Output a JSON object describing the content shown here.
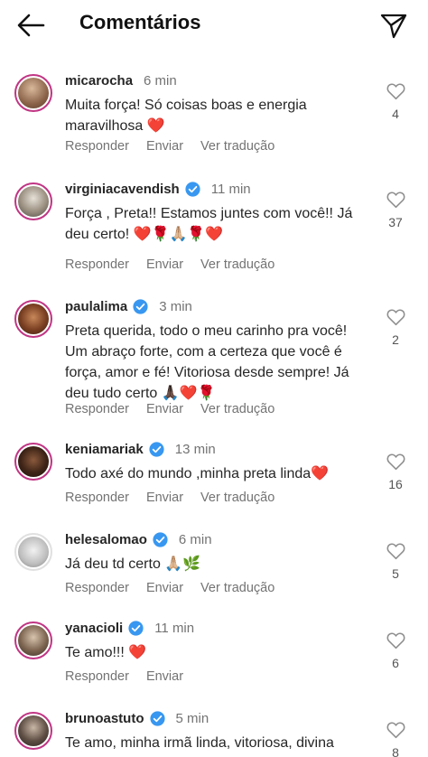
{
  "header": {
    "title": "Comentários"
  },
  "actions": {
    "reply": "Responder",
    "send": "Enviar",
    "translate": "Ver tradução"
  },
  "comments": [
    {
      "username": "micarocha",
      "time": "6 min",
      "text": "Muita força! Só coisas boas e energia maravilhosa ❤️",
      "likes": "4",
      "verified": false
    },
    {
      "username": "virginiacavendish",
      "time": "11 min",
      "text": "Força , Preta!! Estamos juntes com você!! Já deu certo! ❤️🌹🙏🏼🌹❤️",
      "likes": "37",
      "verified": true
    },
    {
      "username": "paulalima",
      "time": "3 min",
      "text": "Preta querida, todo o meu carinho pra você! Um abraço forte, com a certeza que você é força, amor e fé! Vitoriosa desde sempre! Já deu tudo certo 🙏🏿❤️🌹",
      "likes": "2",
      "verified": true
    },
    {
      "username": "keniamariak",
      "time": "13 min",
      "text": "Todo axé do mundo ,minha preta linda❤️",
      "likes": "16",
      "verified": true
    },
    {
      "username": "helesalomao",
      "time": "6 min",
      "text": "Já deu td certo 🙏🏼🌿",
      "likes": "5",
      "verified": true
    },
    {
      "username": "yanacioli",
      "time": "11 min",
      "text": "Te amo!!! ❤️",
      "likes": "6",
      "verified": true
    },
    {
      "username": "brunoastuto",
      "time": "5 min",
      "text": "Te amo, minha irmã linda, vitoriosa, divina",
      "likes": "8",
      "verified": true
    }
  ],
  "colors": {
    "verified": "#3897f0",
    "ring": "#c13584",
    "muted": "#737373"
  }
}
